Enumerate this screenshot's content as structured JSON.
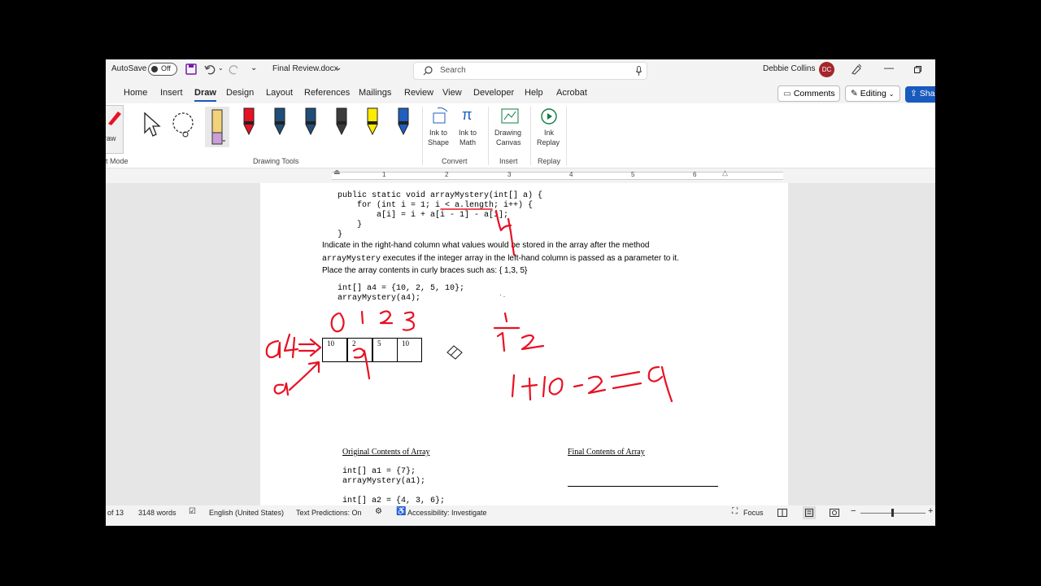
{
  "titlebar": {
    "autosave_label": "AutoSave",
    "autosave_state": "Off",
    "file_name": "Final Review.docx",
    "search_placeholder": "Search",
    "user_name": "Debbie Collins",
    "user_initials": "DC"
  },
  "tabs": [
    "Home",
    "Insert",
    "Draw",
    "Design",
    "Layout",
    "References",
    "Mailings",
    "Review",
    "View",
    "Developer",
    "Help",
    "Acrobat"
  ],
  "actions": {
    "comments": "Comments",
    "editing": "Editing",
    "share": "Sha"
  },
  "ribbon": {
    "draw_button": "raw",
    "mode_label": "t Mode",
    "drawing_tools_label": "Drawing Tools",
    "ink_to_shape": [
      "Ink to",
      "Shape"
    ],
    "ink_to_math": [
      "Ink to",
      "Math"
    ],
    "drawing_canvas": [
      "Drawing",
      "Canvas"
    ],
    "ink_replay": [
      "Ink",
      "Replay"
    ],
    "group_convert": "Convert",
    "group_insert": "Insert",
    "group_replay": "Replay",
    "pen_colors": [
      "#e81123",
      "#1f4e79",
      "#1f4e79",
      "#3b3b3b",
      "#ffeb00",
      "#1f5fbf"
    ]
  },
  "ruler": {
    "numbers": [
      "1",
      "2",
      "3",
      "4",
      "5",
      "6"
    ]
  },
  "document": {
    "code_lines": [
      "public static void arrayMystery(int[] a) {",
      "    for (int i = 1; i < a.length; i++) {",
      "        a[i] = i + a[i - 1] - a[i];",
      "    }",
      "}"
    ],
    "instruction_line1": "Indicate in the right-hand column what values would be stored in the array after the method",
    "instruction_mono": "arrayMystery",
    "instruction_line2_rest": " executes if the integer array in the left-hand column is passed as a parameter to it.",
    "instruction_line3": "Place the array contents in curly braces such as: { 1,3, 5}",
    "example_code": [
      "int[] a4 = {10, 2, 5, 10};",
      "arrayMystery(a4);"
    ],
    "array_cells": [
      "10",
      "2",
      "5",
      "10"
    ],
    "heading_original": "Original Contents of Array",
    "heading_final": "Final Contents of Array",
    "a1_code": [
      "int[] a1 = {7};",
      "arrayMystery(a1);"
    ],
    "a2_code": "int[] a2 = {4, 3, 6};"
  },
  "status": {
    "page": "of 13",
    "words": "3148 words",
    "language": "English (United States)",
    "text_predictions": "Text Predictions: On",
    "accessibility": "Accessibility: Investigate",
    "focus": "Focus"
  },
  "ink_color": "#e81123"
}
